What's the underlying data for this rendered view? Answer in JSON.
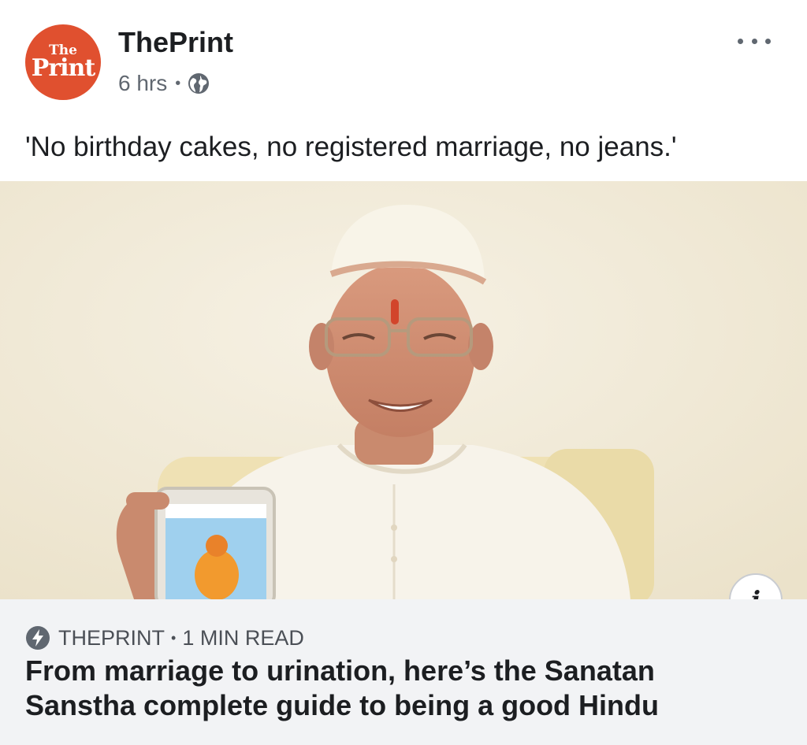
{
  "post": {
    "page_logo": {
      "top": "The",
      "bottom": "Print",
      "color": "#e0502f"
    },
    "page_name": "ThePrint",
    "time": "6 hrs",
    "separator": "•",
    "privacy_icon": "globe-icon",
    "more_icon": "more-dots-icon",
    "caption": "'No birthday cakes, no registered marriage, no jeans.'"
  },
  "link_preview": {
    "info_icon": "info-icon",
    "info_label": "i",
    "instant_article_icon": "lightning-bolt-icon",
    "source": "THEPRINT",
    "separator": "•",
    "read_time": "1 MIN READ",
    "title": "From marriage to urination, here’s the Sanatan Sanstha complete guide to being a good Hindu"
  },
  "colors": {
    "text_primary": "#1c1e21",
    "text_secondary": "#606770",
    "link_box_bg": "#f2f3f5",
    "brand": "#e0502f"
  }
}
